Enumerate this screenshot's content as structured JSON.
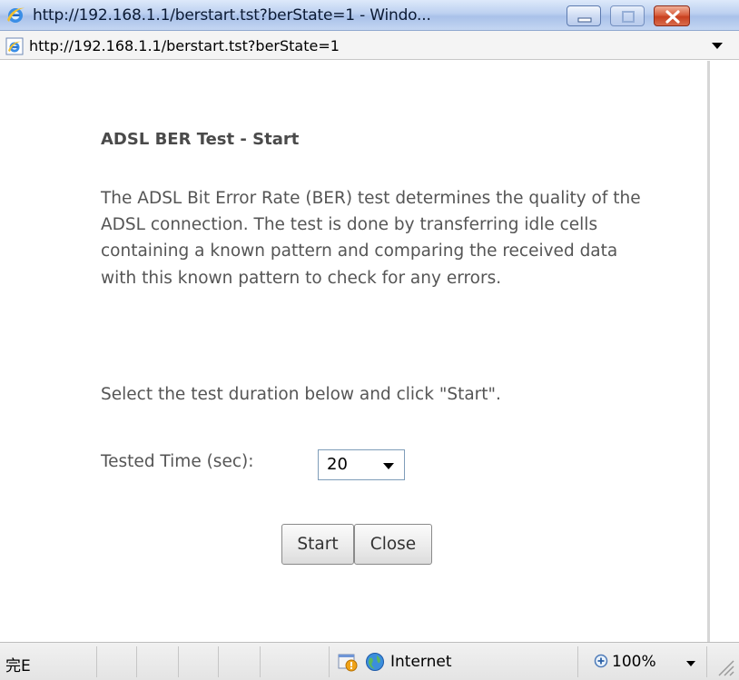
{
  "window": {
    "title": "http://192.168.1.1/berstart.tst?berState=1 - Windo..."
  },
  "addressbar": {
    "url": "http://192.168.1.1/berstart.tst?berState=1"
  },
  "page": {
    "heading": "ADSL BER Test - Start",
    "description": "The ADSL Bit Error Rate (BER) test determines the quality of the ADSL connection. The test is done by transferring idle cells containing a known pattern and comparing the received data with this known pattern to check for any errors.",
    "instruction": "Select the test duration below and click \"Start\".",
    "tested_time_label": "Tested Time (sec):",
    "tested_time_value": "20",
    "start_label": "Start",
    "close_label": "Close"
  },
  "statusbar": {
    "status": "完E",
    "zone": "Internet",
    "zoom": "100%"
  },
  "colors": {
    "text": "#555555",
    "titlebar": "#bcd0f0",
    "close_button": "#c8401f"
  },
  "icons": [
    "ie-logo-icon",
    "minimize-icon",
    "maximize-icon",
    "close-icon",
    "ie-page-icon",
    "dropdown-arrow-icon",
    "shield-warning-icon",
    "globe-icon",
    "zoom-icon",
    "resize-grip-icon"
  ]
}
